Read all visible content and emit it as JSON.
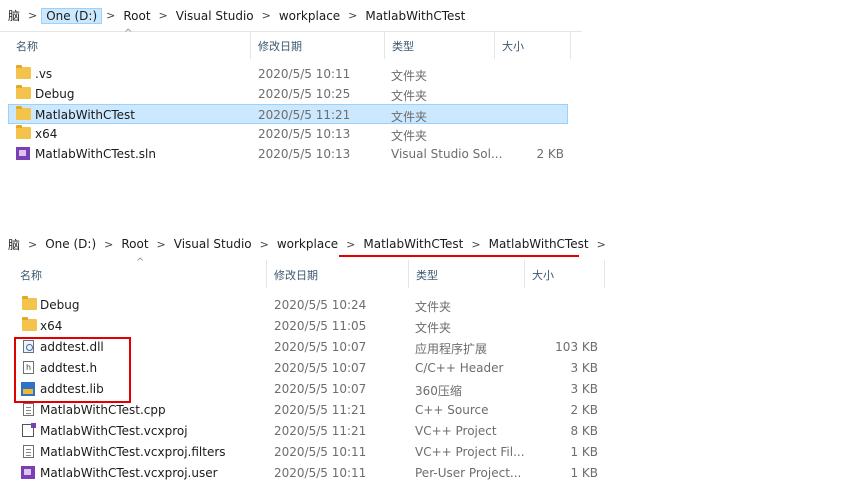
{
  "top_window": {
    "breadcrumb": [
      "脑",
      "One (D:)",
      "Root",
      "Visual Studio",
      "workplace",
      "MatlabWithCTest"
    ],
    "columns": {
      "name": "名称",
      "modified": "修改日期",
      "type": "类型",
      "size": "大小"
    },
    "files": [
      {
        "name": ".vs",
        "date": "2020/5/5 10:11",
        "type": "文件夹",
        "size": "",
        "icon": "folder-icon"
      },
      {
        "name": "Debug",
        "date": "2020/5/5 10:25",
        "type": "文件夹",
        "size": "",
        "icon": "folder-icon"
      },
      {
        "name": "MatlabWithCTest",
        "date": "2020/5/5 11:21",
        "type": "文件夹",
        "size": "",
        "icon": "folder-icon",
        "selected": true
      },
      {
        "name": "x64",
        "date": "2020/5/5 10:13",
        "type": "文件夹",
        "size": "",
        "icon": "folder-icon"
      },
      {
        "name": "MatlabWithCTest.sln",
        "date": "2020/5/5 10:13",
        "type": "Visual Studio Sol...",
        "size": "2 KB",
        "icon": "solution-file-icon"
      }
    ]
  },
  "bottom_window": {
    "breadcrumb": [
      "脑",
      "One (D:)",
      "Root",
      "Visual Studio",
      "workplace",
      "MatlabWithCTest",
      "MatlabWithCTest"
    ],
    "columns": {
      "name": "名称",
      "modified": "修改日期",
      "type": "类型",
      "size": "大小"
    },
    "files": [
      {
        "name": "Debug",
        "date": "2020/5/5 10:24",
        "type": "文件夹",
        "size": "",
        "icon": "folder-icon"
      },
      {
        "name": "x64",
        "date": "2020/5/5 11:05",
        "type": "文件夹",
        "size": "",
        "icon": "folder-icon"
      },
      {
        "name": "addtest.dll",
        "date": "2020/5/5 10:07",
        "type": "应用程序扩展",
        "size": "103 KB",
        "icon": "dll-file-icon"
      },
      {
        "name": "addtest.h",
        "date": "2020/5/5 10:07",
        "type": "C/C++ Header",
        "size": "3 KB",
        "icon": "header-file-icon"
      },
      {
        "name": "addtest.lib",
        "date": "2020/5/5 10:07",
        "type": "360压缩",
        "size": "3 KB",
        "icon": "lib-file-icon"
      },
      {
        "name": "MatlabWithCTest.cpp",
        "date": "2020/5/5 11:21",
        "type": "C++ Source",
        "size": "2 KB",
        "icon": "cpp-file-icon"
      },
      {
        "name": "MatlabWithCTest.vcxproj",
        "date": "2020/5/5 11:21",
        "type": "VC++ Project",
        "size": "8 KB",
        "icon": "vcxproj-file-icon"
      },
      {
        "name": "MatlabWithCTest.vcxproj.filters",
        "date": "2020/5/5 10:11",
        "type": "VC++ Project Fil...",
        "size": "1 KB",
        "icon": "filters-file-icon"
      },
      {
        "name": "MatlabWithCTest.vcxproj.user",
        "date": "2020/5/5 10:11",
        "type": "Per-User Project...",
        "size": "1 KB",
        "icon": "user-file-icon"
      }
    ]
  }
}
